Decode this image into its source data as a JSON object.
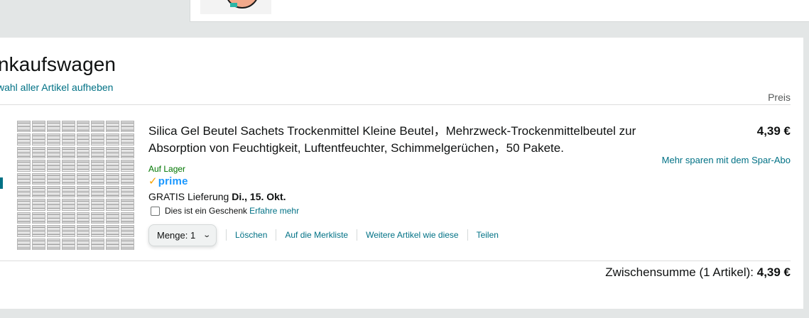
{
  "cart": {
    "title": "nkaufswagen",
    "deselect_all": "wahl aller Artikel aufheben",
    "price_header": "Preis"
  },
  "item": {
    "title": "Silica Gel Beutel Sachets Trockenmittel Kleine Beutel，Mehrzweck-Trockenmittelbeutel zur Absorption von Feuchtigkeit, Luftentfeuchter, Schimmelgerüchen，50 Pakete.",
    "stock": "Auf Lager",
    "prime_check": "✓",
    "prime_label": "prime",
    "delivery_prefix": "GRATIS Lieferung",
    "delivery_date": "Di., 15. Okt.",
    "gift_label": "Dies ist ein Geschenk",
    "gift_link": "Erfahre mehr",
    "quantity_label": "Menge:",
    "quantity_value": "1",
    "actions": {
      "delete": "Löschen",
      "save_for_later": "Auf die Merkliste",
      "more_like_this": "Weitere Artikel wie diese",
      "share": "Teilen"
    },
    "price": "4,39 €",
    "subscribe_save": "Mehr sparen mit dem Spar-Abo"
  },
  "subtotal": {
    "label": "Zwischensumme (1 Artikel):",
    "value": "4,39 €"
  },
  "colors": {
    "link": "#007185",
    "in_stock": "#007600",
    "prime": "#1a98ff",
    "page_bg": "#e3e6e6"
  },
  "icons": {
    "prime_check": "checkmark-icon",
    "quantity_dropdown": "chevron-down-icon",
    "user_avatar": "avatar-icon"
  }
}
